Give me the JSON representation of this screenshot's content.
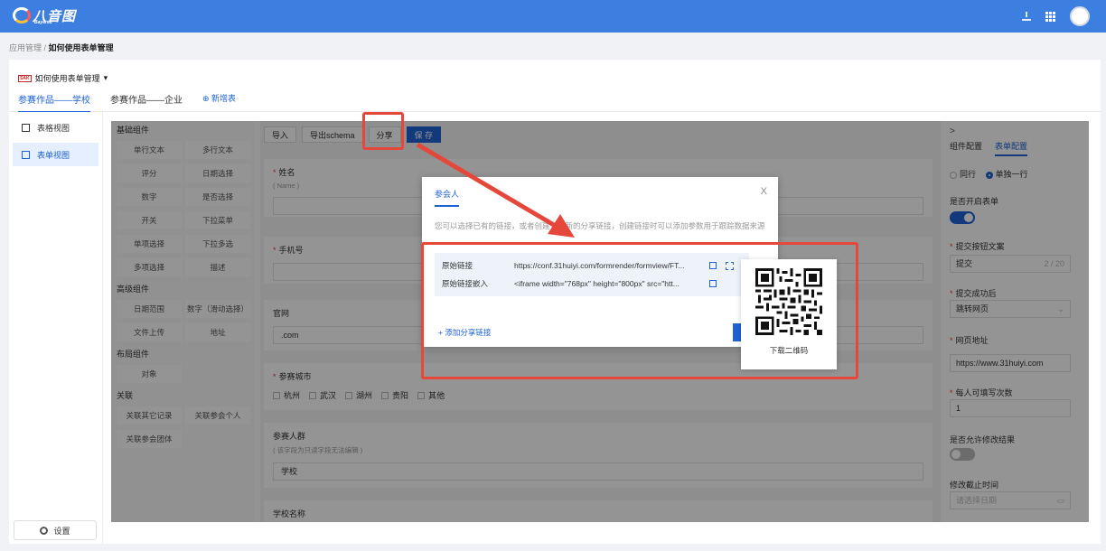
{
  "topbar": {
    "logo_text": "八音图",
    "logo_sub": "Bayantu",
    "icons": [
      "download-icon",
      "apps-grid-icon",
      "user-avatar"
    ]
  },
  "breadcrumb": {
    "parent": "应用管理",
    "current": "如何使用表单管理"
  },
  "header": {
    "app_logo": "SAK",
    "app_name": "如何使用表单管理",
    "tabs": [
      {
        "label": "参赛作品——学校",
        "active": true
      },
      {
        "label": "参赛作品——企业",
        "active": false
      }
    ],
    "add_tab": "新增表"
  },
  "sidebar": {
    "items": [
      {
        "label": "表格视图",
        "active": false
      },
      {
        "label": "表单视图",
        "active": true
      }
    ],
    "settings_label": "设置"
  },
  "palette": {
    "basic_title": "基础组件",
    "basic": [
      "单行文本",
      "多行文本",
      "评分",
      "日期选择",
      "数字",
      "是否选择",
      "开关",
      "下拉菜单",
      "单项选择",
      "下拉多选",
      "多项选择",
      "描述"
    ],
    "advanced_title": "高级组件",
    "advanced": [
      "日期范围",
      "数字（滑动选择）",
      "文件上传",
      "地址"
    ],
    "layout_title": "布局组件",
    "layout": [
      "对象"
    ],
    "relation_title": "关联",
    "relation": [
      "关联其它记录",
      "关联参会个人",
      "关联参会团体"
    ]
  },
  "toolbar": {
    "import": "导入",
    "export": "导出schema",
    "share": "分享",
    "save": "保 存"
  },
  "form": {
    "name_label": "姓名",
    "name_help": "( Name )",
    "phone_label": "手机号",
    "website_label": "官网",
    "website_value": ".com",
    "city_label": "参赛城市",
    "cities": [
      "杭州",
      "武汉",
      "湖州",
      "贵阳",
      "其他"
    ],
    "group_label": "参赛人群",
    "group_help": "( 该字段为只读字段无法编辑 )",
    "group_value": "学校",
    "school_label": "学校名称"
  },
  "right_panel": {
    "collapse": ">",
    "tabs": [
      "组件配置",
      "表单配置"
    ],
    "layout_opt1": "同行",
    "layout_opt2": "单独一行",
    "enable_label": "是否开启表单",
    "enable_on": true,
    "submit_text_label": "提交按钮文案",
    "submit_text_value": "提交",
    "submit_text_count": "2 / 20",
    "after_submit_label": "提交成功后",
    "after_submit_value": "跳转网页",
    "url_label": "网页地址",
    "url_value": "https://www.31huiyi.com",
    "times_label": "每人可填写次数",
    "times_value": "1",
    "allow_edit_label": "是否允许修改结果",
    "allow_edit_on": false,
    "deadline_label": "修改截止时间",
    "deadline_placeholder": "请选择日期"
  },
  "modal": {
    "tab": "参会人",
    "close": "X",
    "description": "您可以选择已有的链接，或者创建一个新的分享链接，创建链接时可以添加参数用于跟踪数据来源",
    "rows": [
      {
        "label": "原始链接",
        "value": "https://conf.31huiyi.com/formrender/formview/FT..."
      },
      {
        "label": "原始链接嵌入",
        "value": "<iframe width=\"768px\" height=\"800px\" src=\"htt..."
      }
    ],
    "add_link": "添加分享链接"
  },
  "qr": {
    "label": "下载二维码"
  },
  "colors": {
    "primary": "#1e62d6",
    "topbar": "#3d7fe0",
    "annotation": "#e5473a"
  }
}
